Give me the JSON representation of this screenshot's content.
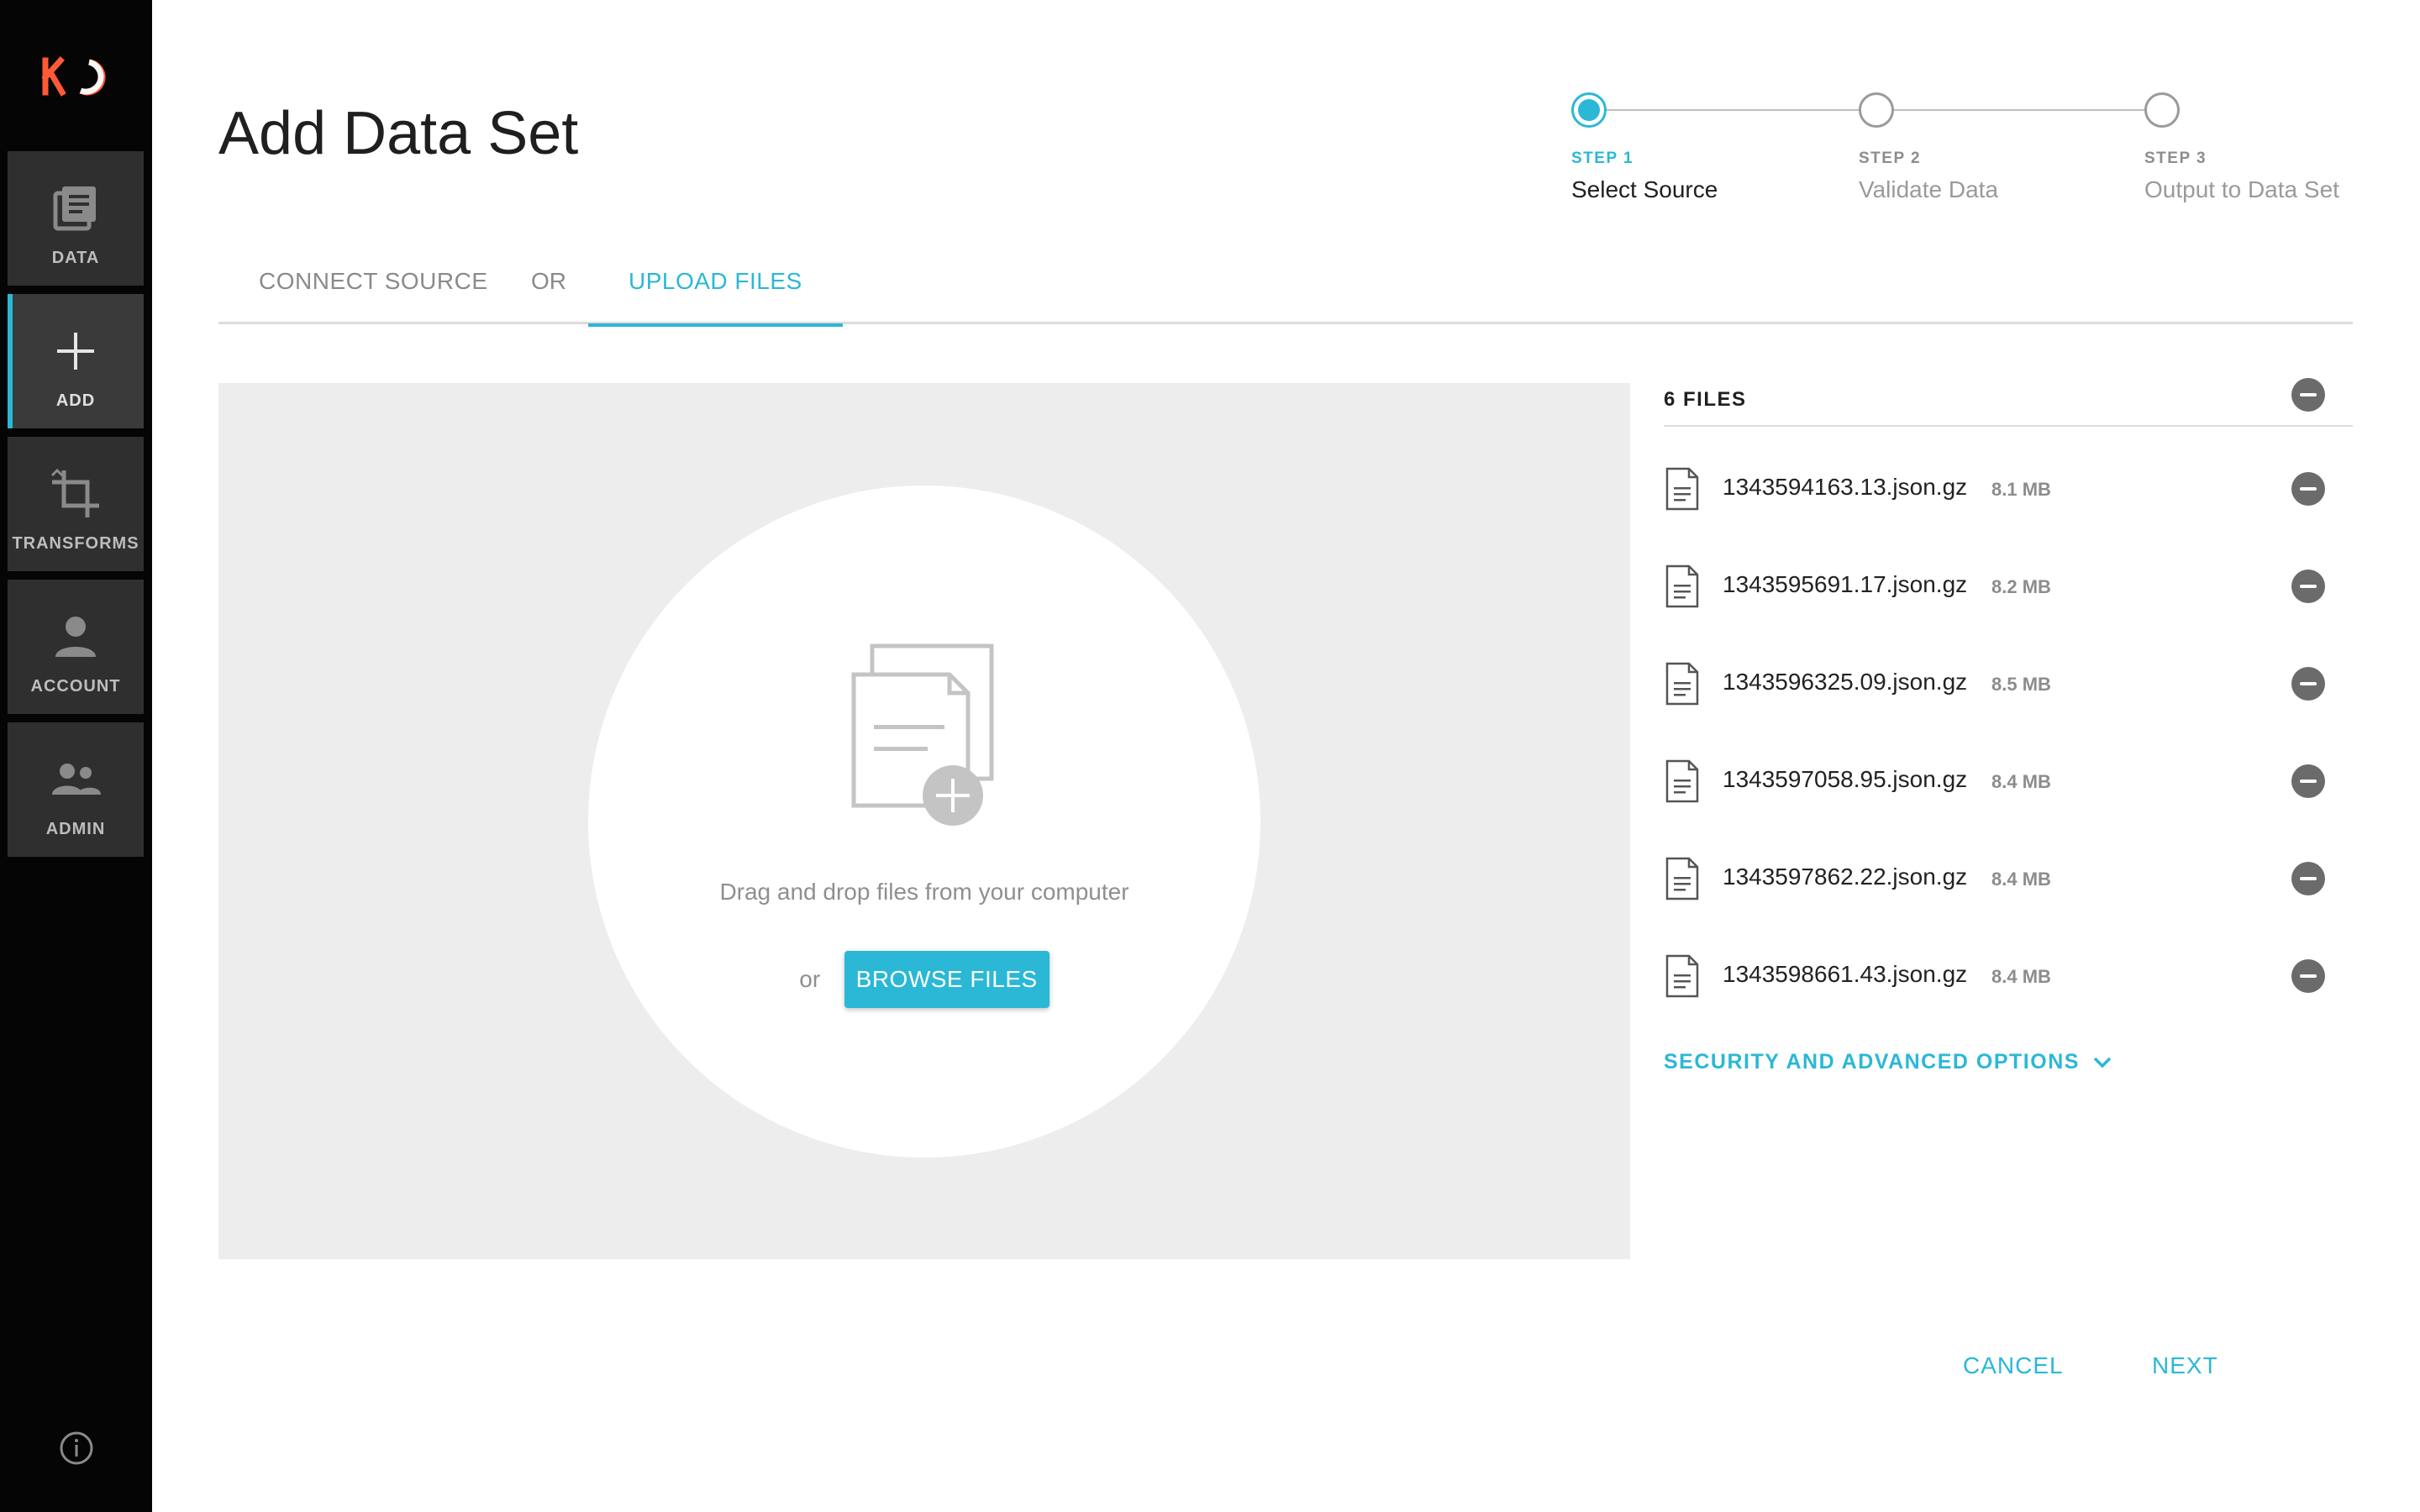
{
  "app": {
    "logo_text": "KO",
    "accent_color": "#2ab8d6",
    "logo_color": "#ff5a36"
  },
  "sidebar": {
    "items": [
      {
        "label": "DATA",
        "icon": "data-icon"
      },
      {
        "label": "ADD",
        "icon": "plus-icon",
        "active": true
      },
      {
        "label": "TRANSFORMS",
        "icon": "crop-icon"
      },
      {
        "label": "ACCOUNT",
        "icon": "person-icon"
      },
      {
        "label": "ADMIN",
        "icon": "people-icon"
      }
    ],
    "footer_icon": "info-icon"
  },
  "header": {
    "title": "Add Data Set"
  },
  "stepper": {
    "steps": [
      {
        "number": "STEP 1",
        "name": "Select Source",
        "active": true
      },
      {
        "number": "STEP 2",
        "name": "Validate Data",
        "active": false
      },
      {
        "number": "STEP 3",
        "name": "Output to Data Set",
        "active": false
      }
    ]
  },
  "tabs": {
    "connect": "CONNECT SOURCE",
    "or": "OR",
    "upload": "UPLOAD FILES",
    "active": "upload"
  },
  "dropzone": {
    "instruction": "Drag and drop files from your computer",
    "or": "or",
    "browse_label": "BROWSE FILES"
  },
  "files": {
    "count_label": "6 FILES",
    "items": [
      {
        "name": "1343594163.13.json.gz",
        "size": "8.1 MB"
      },
      {
        "name": "1343595691.17.json.gz",
        "size": "8.2 MB"
      },
      {
        "name": "1343596325.09.json.gz",
        "size": "8.5 MB"
      },
      {
        "name": "1343597058.95.json.gz",
        "size": "8.4 MB"
      },
      {
        "name": "1343597862.22.json.gz",
        "size": "8.4 MB"
      },
      {
        "name": "1343598661.43.json.gz",
        "size": "8.4 MB"
      }
    ],
    "advanced_label": "SECURITY AND ADVANCED OPTIONS"
  },
  "footer": {
    "cancel": "CANCEL",
    "next": "NEXT"
  }
}
